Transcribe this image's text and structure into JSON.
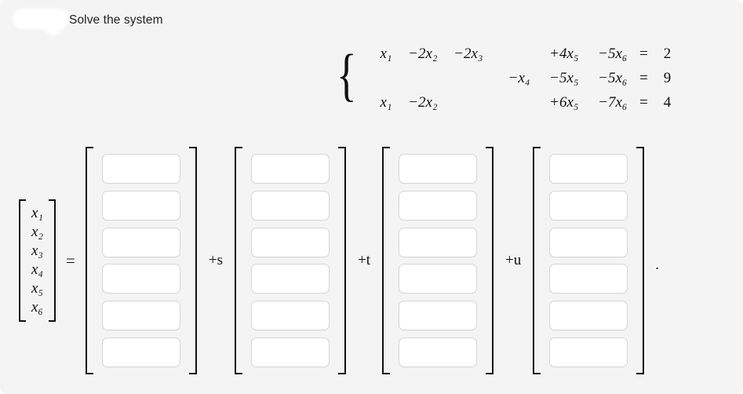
{
  "header": {
    "title": "Solve the system",
    "redaction_label": "redacted-blob"
  },
  "system": {
    "brace": "{",
    "equations": [
      {
        "terms": [
          "x₁",
          "−2x₂",
          "−2x₃",
          "",
          "+4x₅",
          "−5x₆"
        ],
        "equals": "=",
        "rhs": "2"
      },
      {
        "terms": [
          "",
          "",
          "",
          "−x₄",
          "−5x₅",
          "−5x₆"
        ],
        "equals": "=",
        "rhs": "9"
      },
      {
        "terms": [
          "x₁",
          "−2x₂",
          "",
          "",
          "+6x₅",
          "−7x₆"
        ],
        "equals": "=",
        "rhs": "4"
      }
    ],
    "coefficient_matrix": [
      [
        1,
        -2,
        -2,
        0,
        4,
        -5
      ],
      [
        0,
        0,
        0,
        -1,
        -5,
        -5
      ],
      [
        1,
        -2,
        0,
        0,
        6,
        -7
      ]
    ],
    "rhs_vector": [
      2,
      9,
      4
    ],
    "variables": [
      "x₁",
      "x₂",
      "x₃",
      "x₄",
      "x₅",
      "x₆"
    ]
  },
  "solution": {
    "x_vector": [
      "x₁",
      "x₂",
      "x₃",
      "x₄",
      "x₅",
      "x₆"
    ],
    "equals": "=",
    "parameter_labels": [
      "+s",
      "+t",
      "+u"
    ],
    "trailing_punctuation": ".",
    "columns": [
      {
        "name": "particular-solution-vector",
        "values": [
          "",
          "",
          "",
          "",
          "",
          ""
        ],
        "placeholders": [
          "",
          "",
          "",
          "",
          "",
          ""
        ]
      },
      {
        "name": "basis-vector-s",
        "values": [
          "",
          "",
          "",
          "",
          "",
          ""
        ],
        "placeholders": [
          "",
          "",
          "",
          "",
          "",
          ""
        ]
      },
      {
        "name": "basis-vector-t",
        "values": [
          "",
          "",
          "",
          "",
          "",
          ""
        ],
        "placeholders": [
          "",
          "",
          "",
          "",
          "",
          ""
        ]
      },
      {
        "name": "basis-vector-u",
        "values": [
          "",
          "",
          "",
          "",
          "",
          ""
        ],
        "placeholders": [
          "",
          "",
          "",
          "",
          "",
          ""
        ]
      }
    ]
  },
  "colors": {
    "page_background": "#f4f4f4",
    "input_background": "#ffffff",
    "input_border": "#d6d6d6",
    "text": "#101010",
    "bracket": "#111111"
  }
}
